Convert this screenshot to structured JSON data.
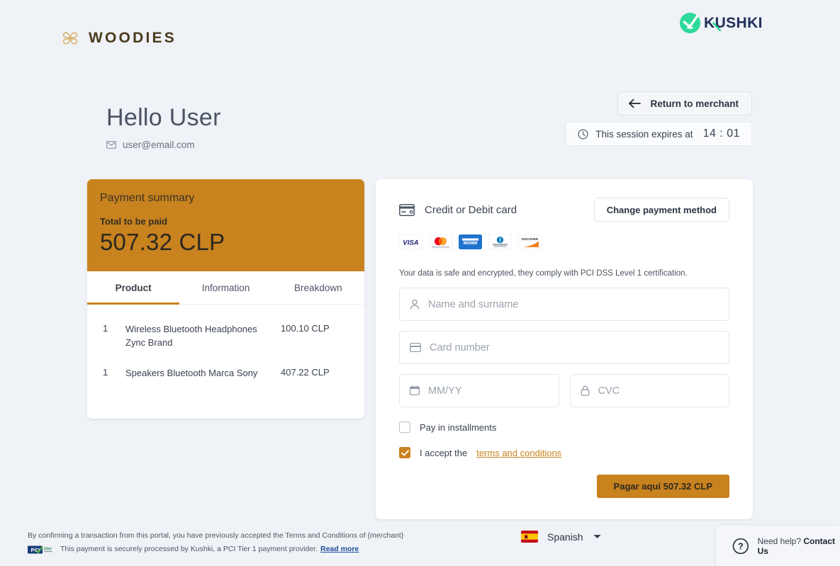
{
  "merchant": {
    "name": "WOODIES",
    "logo_icon": "clover-flower-icon"
  },
  "provider": {
    "name": "KUSHKI",
    "logo_icon": "kushki-check-icon"
  },
  "header": {
    "greeting": "Hello User",
    "email": "user@email.com",
    "email_icon": "envelope-icon",
    "return_button": "Return to merchant",
    "return_icon": "arrow-left-icon",
    "session_icon": "clock-icon",
    "session_text": "This session expires at",
    "session_time": "14 : 01"
  },
  "summary": {
    "title": "Payment summary",
    "total_label": "Total to be paid",
    "total_amount": "507.32 CLP",
    "tabs": [
      {
        "label": "Product",
        "active": true
      },
      {
        "label": "Information",
        "active": false
      },
      {
        "label": "Breakdown",
        "active": false
      }
    ],
    "products": [
      {
        "qty": "1",
        "name": "Wireless Bluetooth Headphones Zync Brand",
        "price": "100.10 CLP"
      },
      {
        "qty": "1",
        "name": "Speakers Bluetooth Marca Sony",
        "price": "407.22 CLP"
      }
    ]
  },
  "payment": {
    "method_label": "Credit or Debit card",
    "method_icon": "credit-card-icon",
    "change_method_button": "Change payment method",
    "brands": [
      "visa",
      "mastercard",
      "amex",
      "diners-club",
      "discover"
    ],
    "security_note": "Your data is safe and encrypted, they comply with PCI DSS Level 1 certification.",
    "fields": [
      {
        "name": "cardholder",
        "icon": "person-icon",
        "placeholder": "Name and surname",
        "value": ""
      },
      {
        "name": "card-number",
        "icon": "card-icon",
        "placeholder": "Card number",
        "value": ""
      },
      {
        "name": "expiry",
        "icon": "calendar-icon",
        "placeholder": "MM/YY",
        "value": ""
      },
      {
        "name": "cvc",
        "icon": "lock-icon",
        "placeholder": "CVC",
        "value": ""
      }
    ],
    "installments_label": "Pay in installments",
    "installments_checked": false,
    "terms_prefix": "I accept the",
    "terms_link": "terms and conditions",
    "terms_checked": true,
    "pay_button": "Pagar aquí 507.32 CLP"
  },
  "footer": {
    "legal_line1": "By confirming a transaction from this portal, you have previously accepted the Terms and Conditions of {merchant}",
    "legal_line2": "This payment is securely processed by Kushki, a PCI Tier 1 payment provider.",
    "read_more": "Read more",
    "pci_badge": "pci-dss-badge",
    "language": "Spanish",
    "language_flag": "spain-flag-icon",
    "language_caret": "chevron-down-icon",
    "help_icon": "question-circle-icon",
    "help_prefix": "Need help?",
    "help_link": "Contact Us"
  },
  "colors": {
    "accent": "#c8821e",
    "background": "#eff2f6",
    "kushki_green": "#2ed99b",
    "kushki_navy": "#23305a",
    "link_blue": "#1f4f9c"
  }
}
